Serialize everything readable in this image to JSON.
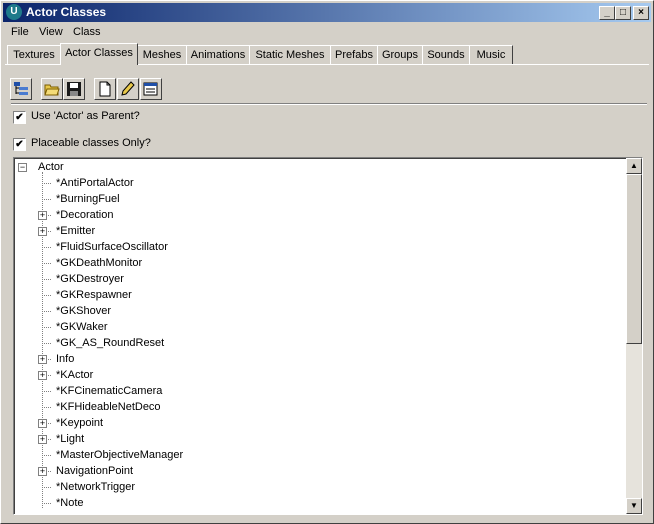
{
  "window": {
    "title": "Actor Classes",
    "app_icon_text": "U",
    "controls": {
      "minimize": "_",
      "maximize": "□",
      "close": "×"
    }
  },
  "menu": [
    "File",
    "View",
    "Class"
  ],
  "tabs": [
    "Textures",
    "Actor Classes",
    "Meshes",
    "Animations",
    "Static Meshes",
    "Prefabs",
    "Groups",
    "Sounds",
    "Music"
  ],
  "active_tab": "Actor Classes",
  "toolbar": {
    "buttons": [
      "tree-view-icon",
      "open-folder-icon",
      "save-icon",
      "new-document-icon",
      "pencil-edit-icon",
      "properties-icon"
    ]
  },
  "options": {
    "use_actor_parent": {
      "label": "Use 'Actor' as Parent?",
      "checked": true,
      "mark": "✔"
    },
    "placeable_only": {
      "label": "Placeable classes Only?",
      "checked": true,
      "mark": "✔"
    }
  },
  "tree": {
    "root": {
      "label": "Actor",
      "expander": "−"
    },
    "children": [
      {
        "label": "*AntiPortalActor",
        "expander": ""
      },
      {
        "label": "*BurningFuel",
        "expander": ""
      },
      {
        "label": "*Decoration",
        "expander": "+"
      },
      {
        "label": "*Emitter",
        "expander": "+"
      },
      {
        "label": "*FluidSurfaceOscillator",
        "expander": ""
      },
      {
        "label": "*GKDeathMonitor",
        "expander": ""
      },
      {
        "label": "*GKDestroyer",
        "expander": ""
      },
      {
        "label": "*GKRespawner",
        "expander": ""
      },
      {
        "label": "*GKShover",
        "expander": ""
      },
      {
        "label": "*GKWaker",
        "expander": ""
      },
      {
        "label": "*GK_AS_RoundReset",
        "expander": ""
      },
      {
        "label": "Info",
        "expander": "+"
      },
      {
        "label": "*KActor",
        "expander": "+"
      },
      {
        "label": "*KFCinematicCamera",
        "expander": ""
      },
      {
        "label": "*KFHideableNetDeco",
        "expander": ""
      },
      {
        "label": "*Keypoint",
        "expander": "+"
      },
      {
        "label": "*Light",
        "expander": "+"
      },
      {
        "label": "*MasterObjectiveManager",
        "expander": ""
      },
      {
        "label": "NavigationPoint",
        "expander": "+"
      },
      {
        "label": "*NetworkTrigger",
        "expander": ""
      },
      {
        "label": "*Note",
        "expander": ""
      }
    ]
  },
  "scrollbar": {
    "up": "▲",
    "down": "▼",
    "position": 0.0
  }
}
